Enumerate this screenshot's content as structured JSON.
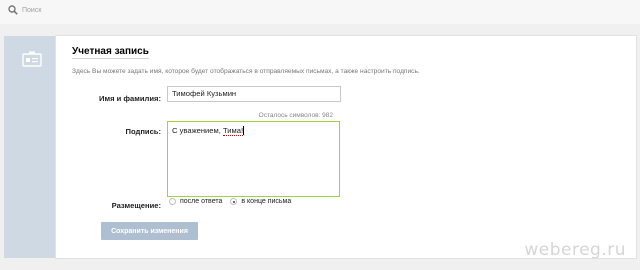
{
  "search": {
    "placeholder": "Поиск",
    "icon": "search-icon"
  },
  "account": {
    "title": "Учетная запись",
    "description": "Здесь Вы можете задать имя, которое будет отображаться в отправляемых письмах, а также настроить подпись.",
    "name_label": "Имя и фамилия:",
    "name_value": "Тимофей Кузьмин",
    "counter": "Осталось символов: 982",
    "signature_label": "Подпись:",
    "signature_prefix": "С уважением, ",
    "signature_word": "Тима!",
    "placement_label": "Размещение:",
    "placement_options": [
      {
        "label": "после ответа",
        "selected": false
      },
      {
        "label": "в конце письма",
        "selected": true
      }
    ],
    "save_label": "Сохранить изменения"
  },
  "watermark": "webereg.ru",
  "colors": {
    "accent_border": "#9fd33b",
    "button": "#aebfd1",
    "sidepanel": "#cfd9e3"
  }
}
